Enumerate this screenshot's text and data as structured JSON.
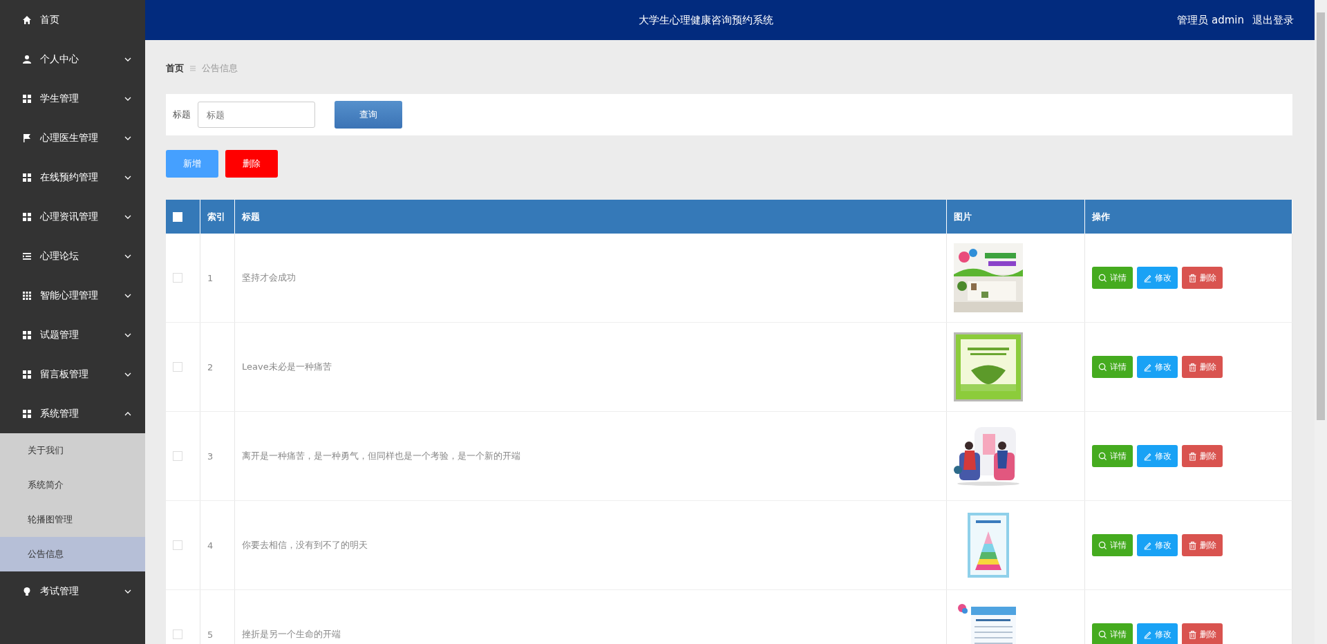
{
  "header": {
    "title": "大学生心理健康咨询预约系统",
    "user": "管理员 admin",
    "logout": "退出登录"
  },
  "sidebar": {
    "items": [
      {
        "label": "首页"
      },
      {
        "label": "个人中心",
        "expanded": false
      },
      {
        "label": "学生管理",
        "expanded": false
      },
      {
        "label": "心理医生管理",
        "expanded": false
      },
      {
        "label": "在线预约管理",
        "expanded": false
      },
      {
        "label": "心理资讯管理",
        "expanded": false
      },
      {
        "label": "心理论坛",
        "expanded": false
      },
      {
        "label": "智能心理管理",
        "expanded": false
      },
      {
        "label": "试题管理",
        "expanded": false
      },
      {
        "label": "留言板管理",
        "expanded": false
      },
      {
        "label": "系统管理",
        "expanded": true,
        "children": [
          {
            "label": "关于我们",
            "selected": false
          },
          {
            "label": "系统简介",
            "selected": false
          },
          {
            "label": "轮播图管理",
            "selected": false
          },
          {
            "label": "公告信息",
            "selected": true
          }
        ]
      },
      {
        "label": "考试管理",
        "expanded": false
      }
    ]
  },
  "breadcrumb": [
    {
      "label": "首页",
      "current": false
    },
    {
      "label": "公告信息",
      "current": true
    }
  ],
  "search": {
    "label": "标题",
    "placeholder": "标题",
    "button": "查询"
  },
  "actions": [
    {
      "label": "新增",
      "kind": "add"
    },
    {
      "label": "删除",
      "kind": "delete"
    }
  ],
  "table": {
    "select_all": false,
    "columns": [
      "索引",
      "标题",
      "图片",
      "操作"
    ],
    "rows": [
      {
        "checked": false,
        "index": "1",
        "title": "坚持才会成功",
        "image": {
          "kind": "picture"
        },
        "actions": [
          {
            "label": "详情",
            "kind": "detail"
          },
          {
            "label": "修改",
            "kind": "edit"
          },
          {
            "label": "删除",
            "kind": "delete"
          }
        ]
      },
      {
        "checked": false,
        "index": "2",
        "title": "Leave未必是一种痛苦",
        "image": {
          "kind": "picture"
        },
        "actions": [
          {
            "label": "详情",
            "kind": "detail"
          },
          {
            "label": "修改",
            "kind": "edit"
          },
          {
            "label": "删除",
            "kind": "delete"
          }
        ]
      },
      {
        "checked": false,
        "index": "3",
        "title": "离开是一种痛苦，是一种勇气，但同样也是一个考验，是一个新的开端",
        "image": {
          "kind": "picture"
        },
        "actions": [
          {
            "label": "详情",
            "kind": "detail"
          },
          {
            "label": "修改",
            "kind": "edit"
          },
          {
            "label": "删除",
            "kind": "delete"
          }
        ]
      },
      {
        "checked": false,
        "index": "4",
        "title": "你要去相信，没有到不了的明天",
        "image": {
          "kind": "picture"
        },
        "actions": [
          {
            "label": "详情",
            "kind": "detail"
          },
          {
            "label": "修改",
            "kind": "edit"
          },
          {
            "label": "删除",
            "kind": "delete"
          }
        ]
      },
      {
        "checked": false,
        "index": "5",
        "title": "挫折是另一个生命的开端",
        "image": {
          "kind": "picture"
        },
        "actions": [
          {
            "label": "详情",
            "kind": "detail"
          },
          {
            "label": "修改",
            "kind": "edit"
          },
          {
            "label": "删除",
            "kind": "delete"
          }
        ]
      }
    ]
  }
}
